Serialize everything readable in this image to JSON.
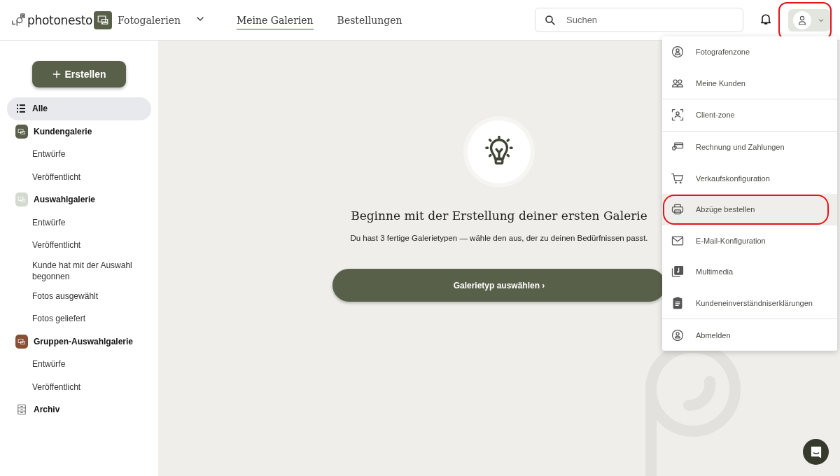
{
  "header": {
    "logo": "photonesto",
    "product": {
      "label": "Fotogalerien"
    },
    "nav": [
      {
        "label": "Meine Galerien",
        "selected": true
      },
      {
        "label": "Bestellungen",
        "selected": false
      }
    ],
    "search": {
      "placeholder": "Suchen"
    },
    "account_button": {
      "annotated": true
    }
  },
  "sidebar": {
    "create_button": "Erstellen",
    "items": [
      {
        "label": "Alle",
        "kind": "all",
        "selected": true
      },
      {
        "label": "Kundengalerie",
        "kind": "gallery",
        "color": "#59604a",
        "selected": false,
        "children": [
          {
            "label": "Entwürfe",
            "selected": false
          },
          {
            "label": "Veröffentlicht",
            "selected": false
          }
        ]
      },
      {
        "label": "Auswahlgalerie",
        "kind": "gallery",
        "color": "#d3dacf",
        "selected": false,
        "children": [
          {
            "label": "Entwürfe",
            "selected": false
          },
          {
            "label": "Veröffentlicht",
            "selected": false
          },
          {
            "label": "Kunde hat mit der Auswahl begonnen",
            "selected": false
          },
          {
            "label": "Fotos ausgewählt",
            "selected": false
          },
          {
            "label": "Fotos geliefert",
            "selected": false
          }
        ]
      },
      {
        "label": "Gruppen-Auswahlgalerie",
        "kind": "gallery",
        "color": "#8a4e34",
        "selected": false,
        "children": [
          {
            "label": "Entwürfe",
            "selected": false
          },
          {
            "label": "Veröffentlicht",
            "selected": false
          }
        ]
      },
      {
        "label": "Archiv",
        "kind": "archive",
        "selected": false
      }
    ]
  },
  "empty_state": {
    "title": "Beginne mit der Erstellung deiner ersten Galerie",
    "text": "Du hast 3 fertige Galerietypen — wähle den aus, der zu deinen Bedürfnissen passt.",
    "button": "Galerietyp auswählen ›"
  },
  "account_menu": {
    "sections": [
      [
        {
          "label": "Fotografenzone",
          "highlighted": false,
          "annotated": false
        },
        {
          "label": "Meine Kunden",
          "highlighted": false,
          "annotated": false
        }
      ],
      [
        {
          "label": "Client-zone",
          "highlighted": false,
          "annotated": false
        }
      ],
      [
        {
          "label": "Rechnung und Zahlungen",
          "highlighted": false,
          "annotated": false
        },
        {
          "label": "Verkaufskonfiguration",
          "highlighted": false,
          "annotated": false
        },
        {
          "label": "Abzüge bestellen",
          "highlighted": true,
          "annotated": true
        },
        {
          "label": "E-Mail-Konfiguration",
          "highlighted": false,
          "annotated": false
        },
        {
          "label": "Multimedia",
          "highlighted": false,
          "annotated": false
        },
        {
          "label": "Kundeneinverständniserklärungen",
          "highlighted": false,
          "annotated": false
        }
      ],
      [
        {
          "label": "Abmelden",
          "highlighted": false,
          "annotated": false
        }
      ]
    ]
  }
}
